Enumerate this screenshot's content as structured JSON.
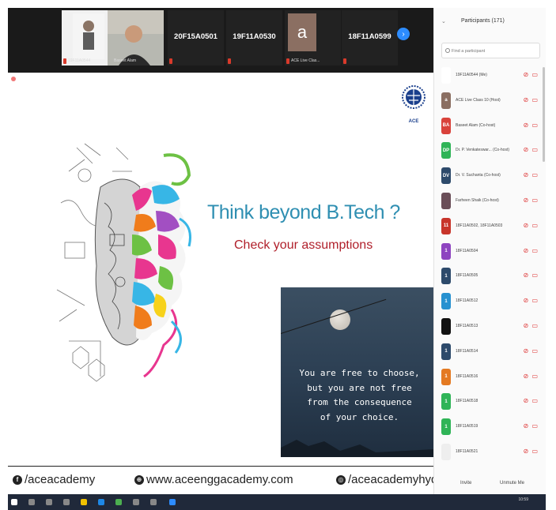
{
  "videos": [
    {
      "name": "",
      "label": "19F11A0544"
    },
    {
      "name": "",
      "label": "Baseet Alam"
    },
    {
      "name": "20F15A0501",
      "label": ""
    },
    {
      "name": "19F11A0530",
      "label": ""
    },
    {
      "name": "a",
      "label": "ACE Live Clas..."
    },
    {
      "name": "18F11A0599",
      "label": ""
    }
  ],
  "slide": {
    "headline": "Think beyond B.Tech ?",
    "subline": "Check your assumptions",
    "logo_text": "ACE",
    "quote": [
      "You are free to choose,",
      "but you are not free",
      "from the consequence",
      "of your choice."
    ],
    "footer": {
      "facebook": "/aceacademy",
      "website": "www.aceenggacademy.com",
      "instagram": "/aceacademyhyd"
    }
  },
  "panel": {
    "title": "Participants (171)",
    "search_placeholder": "Find a participant",
    "participants": [
      {
        "initials": "",
        "name": "19F11A0544 (Me)",
        "color": "#ffffff"
      },
      {
        "initials": "a",
        "name": "ACE Live Class 10 (Host)",
        "color": "#8b6f62"
      },
      {
        "initials": "BA",
        "name": "Baseet Alam (Co-host)",
        "color": "#d9423b"
      },
      {
        "initials": "DP",
        "name": "Dr. P. Venkateswar... (Co-host)",
        "color": "#2fb457"
      },
      {
        "initials": "DV",
        "name": "Dr. V. Suchanta (Co-host)",
        "color": "#2d4a6b"
      },
      {
        "initials": "",
        "name": "Farheen Shaik (Co-host)",
        "color": "#6a4e58"
      },
      {
        "initials": "11",
        "name": "18F11A0502, 18F11A0503",
        "color": "#c8352b"
      },
      {
        "initials": "1",
        "name": "18F11A0504",
        "color": "#8e44c0"
      },
      {
        "initials": "1",
        "name": "18F11A0505",
        "color": "#2d4a6b"
      },
      {
        "initials": "1",
        "name": "18F11A0512",
        "color": "#2791d0"
      },
      {
        "initials": "",
        "name": "18F11A0513",
        "color": "#111111"
      },
      {
        "initials": "1",
        "name": "18F11A0514",
        "color": "#2d4a6b"
      },
      {
        "initials": "1",
        "name": "18F11A0516",
        "color": "#e47a22"
      },
      {
        "initials": "1",
        "name": "18F11A0518",
        "color": "#2fb457"
      },
      {
        "initials": "1",
        "name": "18F11A0519",
        "color": "#2fb457"
      },
      {
        "initials": "",
        "name": "18F11A0521",
        "color": "#eeeeee"
      }
    ],
    "invite": "Invite",
    "unmute_me": "Unmute Me"
  },
  "taskbar": {
    "time": "10:59"
  }
}
